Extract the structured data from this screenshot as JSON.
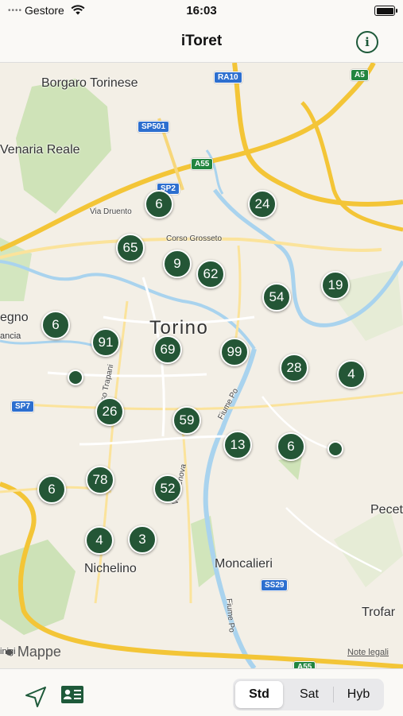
{
  "status_bar": {
    "carrier": "Gestore",
    "time": "16:03"
  },
  "nav": {
    "title": "iToret"
  },
  "map": {
    "places": {
      "borgaro": "Borgaro Torinese",
      "venaria": "Venaria Reale",
      "torino": "Torino",
      "egno": "egno",
      "ancia": "ancia",
      "moncalieri": "Moncalieri",
      "nichelino": "Nichelino",
      "pecett": "Pecett",
      "trofar": "Trofar",
      "inigi": "inigi"
    },
    "roads": {
      "via_druento": "Via Druento",
      "corso_grosseto": "Corso Grosseto",
      "corso_trapani": "Corso Trapani",
      "fiume_po": "Fiume Po",
      "via_genova": "Via Genova",
      "fiume_po_2": "Fiume Po"
    },
    "shields": {
      "ra10": "RA10",
      "a5": "A5",
      "sp501": "SP501",
      "a55": "A55",
      "sp2": "SP2",
      "sp7": "SP7",
      "ss29": "SS29",
      "a55_south": "A55"
    },
    "clusters": [
      "6",
      "24",
      "65",
      "9",
      "62",
      "19",
      "54",
      "6",
      "91",
      "69",
      "99",
      "28",
      "4",
      "26",
      "59",
      "13",
      "6",
      "6",
      "78",
      "52",
      "4",
      "3"
    ],
    "brand": "Mappe",
    "legal": "Note legali"
  },
  "map_types": {
    "std": "Std",
    "sat": "Sat",
    "hyb": "Hyb",
    "selected": "Std"
  },
  "colors": {
    "accent": "#1e5a3a",
    "pin": "#245636"
  }
}
